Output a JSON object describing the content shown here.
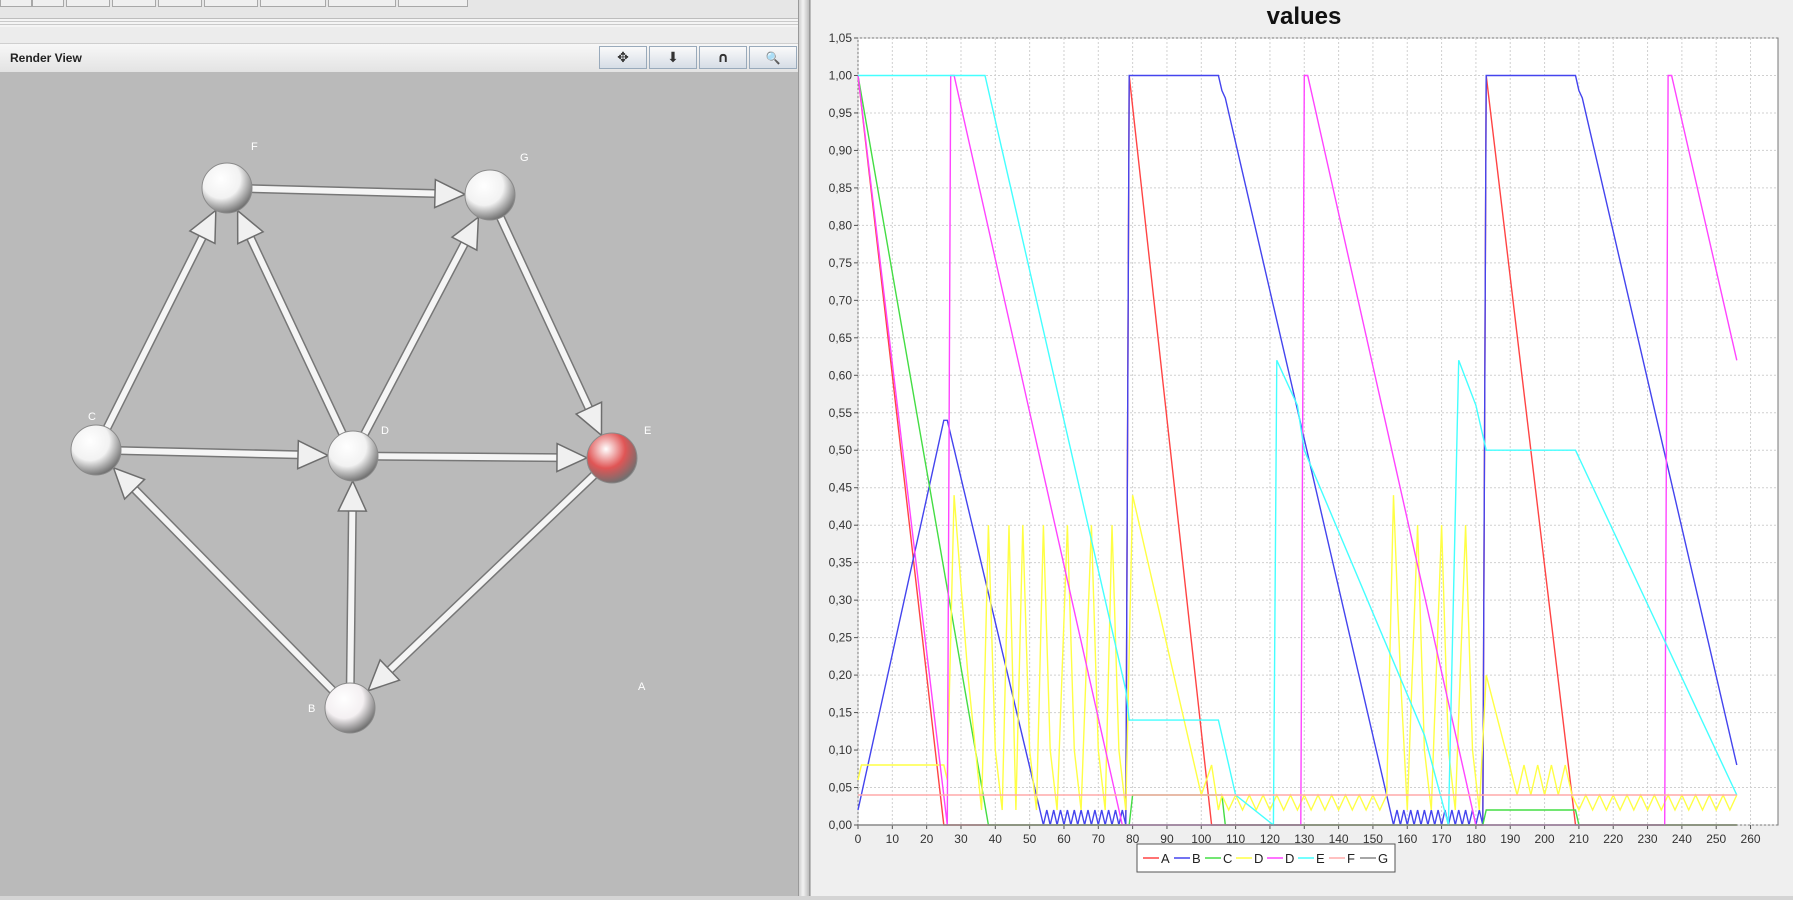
{
  "toolbar": {
    "buttons": [
      "",
      "",
      "",
      "",
      "",
      "",
      "",
      ""
    ]
  },
  "render_view": {
    "title": "Render View",
    "buttons": [
      {
        "name": "move-icon",
        "glyph": "✥"
      },
      {
        "name": "arrow-down-icon",
        "glyph": "⬇"
      },
      {
        "name": "rotate-icon",
        "glyph": "∩"
      },
      {
        "name": "zoom-icon",
        "glyph": "🔍"
      }
    ]
  },
  "graph": {
    "nodes": [
      {
        "id": "F",
        "label": "F",
        "color": "#f2f2f2"
      },
      {
        "id": "G",
        "label": "G",
        "color": "#f2f2f2"
      },
      {
        "id": "C",
        "label": "C",
        "color": "#f2f2f2"
      },
      {
        "id": "D",
        "label": "D",
        "color": "#f2f2f2"
      },
      {
        "id": "E",
        "label": "E",
        "color": "#e05555"
      },
      {
        "id": "B",
        "label": "B",
        "color": "#f4f0f2"
      },
      {
        "id": "A",
        "label": "A",
        "color": null
      }
    ],
    "edges": [
      {
        "from": "F",
        "to": "G"
      },
      {
        "from": "C",
        "to": "F"
      },
      {
        "from": "D",
        "to": "F"
      },
      {
        "from": "D",
        "to": "G"
      },
      {
        "from": "G",
        "to": "E"
      },
      {
        "from": "C",
        "to": "D"
      },
      {
        "from": "D",
        "to": "E"
      },
      {
        "from": "B",
        "to": "C"
      },
      {
        "from": "B",
        "to": "D"
      },
      {
        "from": "E",
        "to": "B"
      }
    ]
  },
  "chart_data": {
    "type": "line",
    "title": "values",
    "xlim": [
      0,
      268
    ],
    "ylim": [
      0,
      1.05
    ],
    "x_ticks": [
      0,
      10,
      20,
      30,
      40,
      50,
      60,
      70,
      80,
      90,
      100,
      110,
      120,
      130,
      140,
      150,
      160,
      170,
      180,
      190,
      200,
      210,
      220,
      230,
      240,
      250,
      260
    ],
    "y_ticks": [
      "0,00",
      "0,05",
      "0,10",
      "0,15",
      "0,20",
      "0,25",
      "0,30",
      "0,35",
      "0,40",
      "0,45",
      "0,50",
      "0,55",
      "0,60",
      "0,65",
      "0,70",
      "0,75",
      "0,80",
      "0,85",
      "0,90",
      "0,95",
      "1,00",
      "1,05"
    ],
    "grid": true,
    "legend_position": "bottom",
    "series": [
      {
        "name": "A",
        "color": "#ff4444",
        "points": [
          [
            0,
            1.0
          ],
          [
            25,
            0
          ],
          [
            78,
            0
          ],
          [
            79,
            1.0
          ],
          [
            103,
            0
          ],
          [
            182,
            0
          ],
          [
            183,
            1.0
          ],
          [
            209,
            0
          ],
          [
            256,
            0
          ]
        ]
      },
      {
        "name": "B",
        "color": "#4444ee",
        "points": [
          [
            0,
            0.02
          ],
          [
            25,
            0.54
          ],
          [
            26,
            0.54
          ],
          [
            53,
            0.02
          ],
          [
            54,
            0.0
          ],
          [
            55,
            0.02
          ],
          [
            56,
            0.0
          ],
          [
            57,
            0.02
          ],
          [
            58,
            0.0
          ],
          [
            59,
            0.02
          ],
          [
            60,
            0.0
          ],
          [
            61,
            0.02
          ],
          [
            62,
            0.0
          ],
          [
            63,
            0.02
          ],
          [
            64,
            0.0
          ],
          [
            65,
            0.02
          ],
          [
            66,
            0.0
          ],
          [
            67,
            0.02
          ],
          [
            68,
            0.0
          ],
          [
            69,
            0.02
          ],
          [
            70,
            0.0
          ],
          [
            71,
            0.02
          ],
          [
            72,
            0.0
          ],
          [
            73,
            0.02
          ],
          [
            74,
            0.0
          ],
          [
            75,
            0.02
          ],
          [
            76,
            0.0
          ],
          [
            77,
            0.02
          ],
          [
            78,
            0.0
          ],
          [
            79,
            1.0
          ],
          [
            105,
            1.0
          ],
          [
            106,
            0.98
          ],
          [
            107,
            0.97
          ],
          [
            155,
            0.02
          ],
          [
            156,
            0.0
          ],
          [
            157,
            0.02
          ],
          [
            158,
            0.0
          ],
          [
            159,
            0.02
          ],
          [
            160,
            0.0
          ],
          [
            161,
            0.02
          ],
          [
            162,
            0.0
          ],
          [
            163,
            0.02
          ],
          [
            164,
            0.0
          ],
          [
            165,
            0.02
          ],
          [
            166,
            0.0
          ],
          [
            167,
            0.02
          ],
          [
            168,
            0.0
          ],
          [
            169,
            0.02
          ],
          [
            170,
            0.0
          ],
          [
            171,
            0.02
          ],
          [
            172,
            0.0
          ],
          [
            173,
            0.02
          ],
          [
            174,
            0.0
          ],
          [
            175,
            0.02
          ],
          [
            176,
            0.0
          ],
          [
            177,
            0.02
          ],
          [
            178,
            0.0
          ],
          [
            179,
            0.02
          ],
          [
            180,
            0.0
          ],
          [
            181,
            0.02
          ],
          [
            182,
            0.0
          ],
          [
            183,
            1.0
          ],
          [
            209,
            1.0
          ],
          [
            210,
            0.98
          ],
          [
            211,
            0.97
          ],
          [
            256,
            0.08
          ]
        ]
      },
      {
        "name": "C",
        "color": "#44dd44",
        "points": [
          [
            0,
            1.0
          ],
          [
            38,
            0
          ],
          [
            79,
            0
          ],
          [
            80,
            0.04
          ],
          [
            106,
            0.04
          ],
          [
            107,
            0
          ],
          [
            182,
            0
          ],
          [
            183,
            0.02
          ],
          [
            209,
            0.02
          ],
          [
            210,
            0
          ],
          [
            256,
            0
          ]
        ]
      },
      {
        "name": "D",
        "color": "#ffff44",
        "points": [
          [
            0,
            0.06
          ],
          [
            1,
            0.08
          ],
          [
            25,
            0.08
          ],
          [
            26,
            0.06
          ],
          [
            28,
            0.44
          ],
          [
            32,
            0.2
          ],
          [
            36,
            0.02
          ],
          [
            38,
            0.4
          ],
          [
            40,
            0.1
          ],
          [
            42,
            0.02
          ],
          [
            44,
            0.4
          ],
          [
            46,
            0.02
          ],
          [
            48,
            0.4
          ],
          [
            50,
            0.1
          ],
          [
            52,
            0.02
          ],
          [
            54,
            0.4
          ],
          [
            56,
            0.1
          ],
          [
            58,
            0.02
          ],
          [
            61,
            0.4
          ],
          [
            63,
            0.1
          ],
          [
            65,
            0.02
          ],
          [
            68,
            0.4
          ],
          [
            70,
            0.1
          ],
          [
            72,
            0.02
          ],
          [
            74,
            0.4
          ],
          [
            76,
            0.1
          ],
          [
            78,
            0.02
          ],
          [
            80,
            0.44
          ],
          [
            95,
            0.14
          ],
          [
            100,
            0.04
          ],
          [
            103,
            0.08
          ],
          [
            105,
            0.02
          ],
          [
            106,
            0.04
          ],
          [
            108,
            0.02
          ],
          [
            110,
            0.04
          ],
          [
            112,
            0.02
          ],
          [
            114,
            0.04
          ],
          [
            116,
            0.02
          ],
          [
            118,
            0.04
          ],
          [
            120,
            0.02
          ],
          [
            122,
            0.04
          ],
          [
            124,
            0.02
          ],
          [
            126,
            0.04
          ],
          [
            128,
            0.02
          ],
          [
            130,
            0.04
          ],
          [
            132,
            0.02
          ],
          [
            134,
            0.04
          ],
          [
            136,
            0.02
          ],
          [
            138,
            0.04
          ],
          [
            140,
            0.02
          ],
          [
            142,
            0.04
          ],
          [
            144,
            0.02
          ],
          [
            146,
            0.04
          ],
          [
            148,
            0.02
          ],
          [
            150,
            0.04
          ],
          [
            152,
            0.02
          ],
          [
            154,
            0.04
          ],
          [
            156,
            0.44
          ],
          [
            158,
            0.2
          ],
          [
            160,
            0.02
          ],
          [
            163,
            0.4
          ],
          [
            165,
            0.1
          ],
          [
            167,
            0.02
          ],
          [
            170,
            0.4
          ],
          [
            172,
            0.1
          ],
          [
            174,
            0.02
          ],
          [
            177,
            0.4
          ],
          [
            179,
            0.1
          ],
          [
            181,
            0.02
          ],
          [
            183,
            0.2
          ],
          [
            192,
            0.04
          ],
          [
            194,
            0.08
          ],
          [
            196,
            0.04
          ],
          [
            198,
            0.08
          ],
          [
            200,
            0.04
          ],
          [
            202,
            0.08
          ],
          [
            204,
            0.04
          ],
          [
            206,
            0.08
          ],
          [
            208,
            0.04
          ],
          [
            210,
            0.02
          ],
          [
            212,
            0.04
          ],
          [
            214,
            0.02
          ],
          [
            216,
            0.04
          ],
          [
            218,
            0.02
          ],
          [
            220,
            0.04
          ],
          [
            222,
            0.02
          ],
          [
            224,
            0.04
          ],
          [
            226,
            0.02
          ],
          [
            228,
            0.04
          ],
          [
            230,
            0.02
          ],
          [
            232,
            0.04
          ],
          [
            234,
            0.02
          ],
          [
            236,
            0.04
          ],
          [
            238,
            0.02
          ],
          [
            240,
            0.04
          ],
          [
            242,
            0.02
          ],
          [
            244,
            0.04
          ],
          [
            246,
            0.02
          ],
          [
            248,
            0.04
          ],
          [
            250,
            0.02
          ],
          [
            252,
            0.04
          ],
          [
            254,
            0.02
          ],
          [
            256,
            0.04
          ]
        ]
      },
      {
        "name": "D",
        "color": "#ff44ff",
        "points": [
          [
            0,
            1.0
          ],
          [
            26,
            0
          ],
          [
            27,
            1.0
          ],
          [
            28,
            1.0
          ],
          [
            77,
            0
          ],
          [
            129,
            0
          ],
          [
            130,
            1.0
          ],
          [
            131,
            1.0
          ],
          [
            180,
            0
          ],
          [
            235,
            0
          ],
          [
            236,
            1.0
          ],
          [
            237,
            1.0
          ],
          [
            256,
            0.62
          ]
        ]
      },
      {
        "name": "E",
        "color": "#44ffff",
        "points": [
          [
            0,
            1.0
          ],
          [
            37,
            1.0
          ],
          [
            78,
            0.18
          ],
          [
            79,
            0.14
          ],
          [
            105,
            0.14
          ],
          [
            106,
            0.12
          ],
          [
            110,
            0.04
          ],
          [
            121,
            0.0
          ],
          [
            122,
            0.62
          ],
          [
            128,
            0.56
          ],
          [
            130,
            0.5
          ],
          [
            165,
            0.12
          ],
          [
            172,
            0.0
          ],
          [
            175,
            0.62
          ],
          [
            180,
            0.56
          ],
          [
            183,
            0.5
          ],
          [
            209,
            0.5
          ],
          [
            256,
            0.04
          ]
        ]
      },
      {
        "name": "F",
        "color": "#ffaaaa",
        "points": [
          [
            0,
            0.04
          ],
          [
            256,
            0.04
          ]
        ]
      },
      {
        "name": "G",
        "color": "#888888",
        "points": [
          [
            0,
            0.0
          ],
          [
            256,
            0.0
          ]
        ]
      }
    ]
  }
}
